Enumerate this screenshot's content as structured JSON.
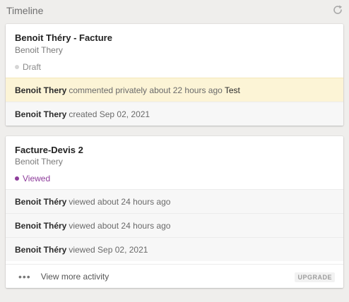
{
  "header": {
    "title": "Timeline"
  },
  "documents": [
    {
      "title": "Benoit Théry - Facture",
      "subtitle": "Benoit Thery",
      "status": "Draft",
      "activities": [
        {
          "actor": "Benoit Thery",
          "action": "commented privately about 22 hours ago",
          "note": "Test"
        },
        {
          "actor": "Benoit Thery",
          "action": "created Sep 02, 2021"
        }
      ]
    },
    {
      "title": "Facture-Devis 2",
      "subtitle": "Benoit Thery",
      "status": "Viewed",
      "activities": [
        {
          "actor": "Benoit Théry",
          "action": "viewed about 24 hours ago"
        },
        {
          "actor": "Benoit Théry",
          "action": "viewed about 24 hours ago"
        },
        {
          "actor": "Benoit Théry",
          "action": "viewed Sep 02, 2021"
        }
      ],
      "more": {
        "label": "View more activity",
        "badge": "UPGRADE"
      }
    }
  ],
  "colors": {
    "draft_dot": "#d6d6d6",
    "viewed": "#8e3d9b",
    "highlight_bg": "#fcf4d6"
  },
  "icons": {
    "refresh": "refresh-icon",
    "more": "more-dots-icon",
    "status": "status-dot-icon"
  }
}
